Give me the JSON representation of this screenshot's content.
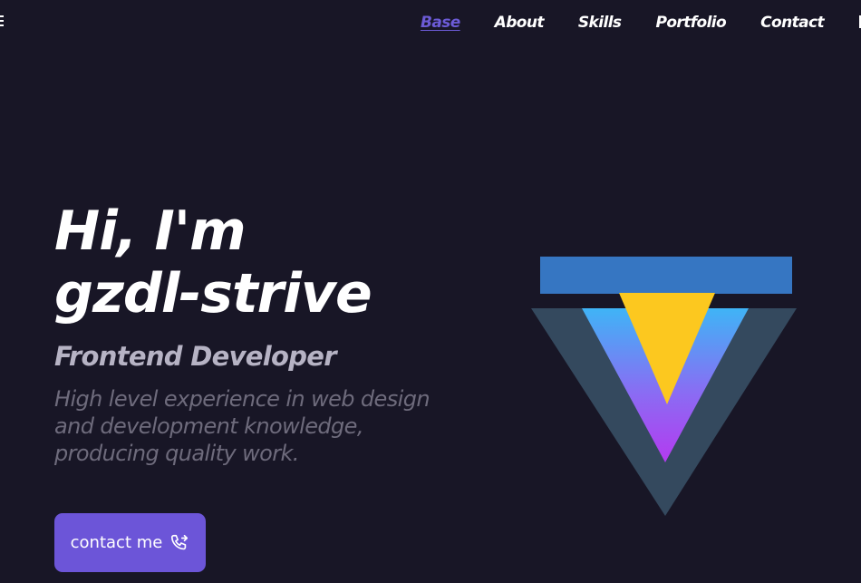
{
  "nav": {
    "items": [
      {
        "label": "Base",
        "active": true
      },
      {
        "label": "About"
      },
      {
        "label": "Skills"
      },
      {
        "label": "Portfolio"
      },
      {
        "label": "Contact"
      }
    ]
  },
  "hero": {
    "greeting_line1": "Hi, I'm",
    "greeting_line2": "gzdl-strive",
    "role": "Frontend Developer",
    "description": "High level experience in web design and development knowledge, producing quality work.",
    "cta_label": "contact me",
    "cta_icon": "phone-forward-icon"
  },
  "colors": {
    "background": "#181626",
    "accent": "#6c55d8",
    "nav_active": "#6c5bd6"
  }
}
